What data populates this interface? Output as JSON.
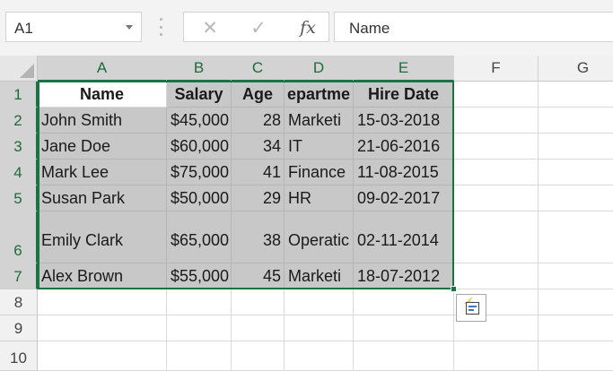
{
  "name_box": {
    "value": "A1"
  },
  "formula_bar": {
    "cancel_glyph": "✕",
    "enter_glyph": "✓",
    "fx_label": "fx",
    "value": "Name"
  },
  "columns": [
    "A",
    "B",
    "C",
    "D",
    "E",
    "F",
    "G"
  ],
  "rows": [
    "1",
    "2",
    "3",
    "4",
    "5",
    "6",
    "7",
    "8",
    "9",
    "10"
  ],
  "table": {
    "headers": [
      "Name",
      "Salary",
      "Age",
      "epartme",
      "Hire Date"
    ],
    "data": [
      [
        "John Smith",
        "$45,000",
        "28",
        "Marketi",
        "15-03-2018"
      ],
      [
        "Jane Doe",
        "$60,000",
        "34",
        "IT",
        "21-06-2016"
      ],
      [
        "Mark Lee",
        "$75,000",
        "41",
        "Finance",
        "11-08-2015"
      ],
      [
        "Susan Park",
        "$50,000",
        "29",
        "HR",
        "09-02-2017"
      ],
      [
        "Emily Clark",
        "$65,000",
        "38",
        "Operatic",
        "02-11-2014"
      ],
      [
        "Alex Brown",
        "$55,000",
        "45",
        "Marketi",
        "18-07-2012"
      ]
    ]
  },
  "colors": {
    "selection": "#1e7145",
    "selected_fill": "#c8c8c8"
  },
  "quick_analysis": {
    "icon": "quick-analysis-icon"
  }
}
